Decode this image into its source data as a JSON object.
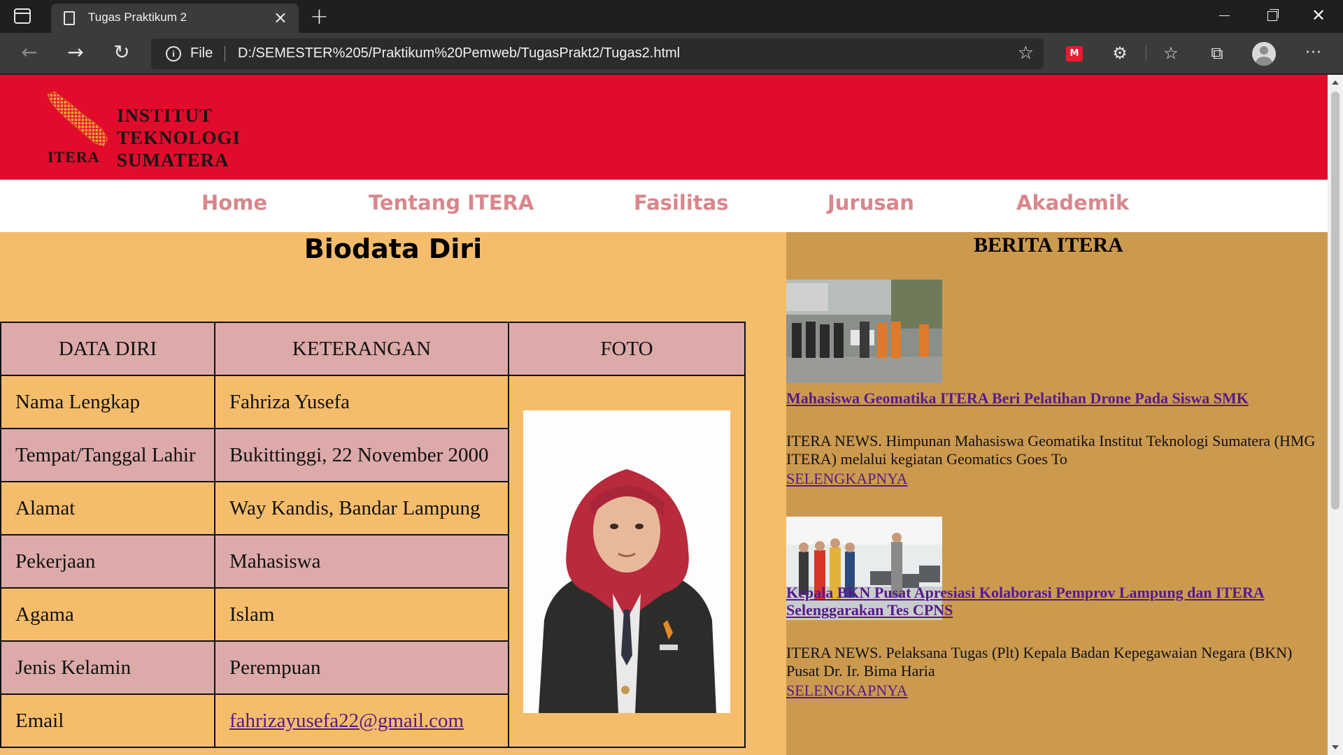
{
  "browser": {
    "tab_title": "Tugas Praktikum 2",
    "scheme_label": "File",
    "url": "D:/SEMESTER%205/Praktikum%20Pemweb/TugasPrakt2/Tugas2.html"
  },
  "site": {
    "logo_acronym": "ITERA",
    "logo_name": [
      "INSTITUT",
      "TEKNOLOGI",
      "SUMATERA"
    ],
    "nav": [
      "Home",
      "Tentang ITERA",
      "Fasilitas",
      "Jurusan",
      "Akademik"
    ]
  },
  "biodata": {
    "title": "Biodata Diri",
    "headers": [
      "DATA DIRI",
      "KETERANGAN",
      "FOTO"
    ],
    "rows": [
      {
        "label": "Nama Lengkap",
        "value": "Fahriza Yusefa"
      },
      {
        "label": "Tempat/Tanggal Lahir",
        "value": "Bukittinggi, 22 November 2000"
      },
      {
        "label": "Alamat",
        "value": "Way Kandis, Bandar Lampung"
      },
      {
        "label": "Pekerjaan",
        "value": "Mahasiswa"
      },
      {
        "label": "Agama",
        "value": "Islam"
      },
      {
        "label": "Jenis Kelamin",
        "value": "Perempuan"
      },
      {
        "label": "Email",
        "value": "fahrizayusefa22@gmail.com"
      }
    ]
  },
  "news": {
    "title": "BERITA ITERA",
    "items": [
      {
        "headline": "Mahasiswa Geomatika ITERA Beri Pelatihan Drone Pada Siswa SMK",
        "summary": "ITERA NEWS. Himpunan Mahasiswa Geomatika Institut Teknologi Sumatera (HMG ITERA) melalui kegiatan Geomatics Goes To",
        "more": "SELENGKAPNYA"
      },
      {
        "headline": "Kepala BKN Pusat Apresiasi Kolaborasi Pemprov Lampung dan ITERA Selenggarakan Tes CPNS",
        "summary": "ITERA NEWS. Pelaksana Tugas (Plt) Kepala Badan Kepegawaian Negara (BKN) Pusat Dr. Ir. Bima Haria",
        "more": "SELENGKAPNYA"
      }
    ]
  },
  "colors": {
    "header_red": "#e30b2c",
    "nav_text": "#d8878c",
    "main_bg": "#f5bd6b",
    "aside_bg": "#cc9a4f",
    "table_pink": "#dcaaa9",
    "link": "#551a8b"
  }
}
